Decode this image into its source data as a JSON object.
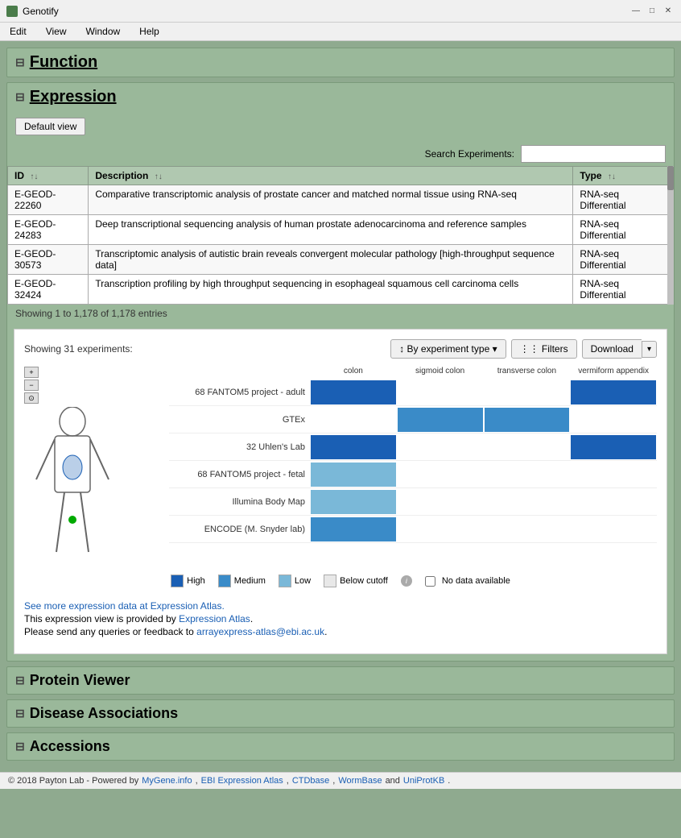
{
  "app": {
    "title": "Genotify",
    "icon": "G"
  },
  "titlebar": {
    "minimize": "—",
    "maximize": "□",
    "close": "✕"
  },
  "menubar": {
    "items": [
      "Edit",
      "View",
      "Window",
      "Help"
    ]
  },
  "function_section": {
    "toggle": "⊟",
    "title": "Function"
  },
  "expression_section": {
    "toggle": "⊟",
    "title": "Expression",
    "default_view_label": "Default view",
    "search_label": "Search Experiments:",
    "search_placeholder": ""
  },
  "table": {
    "columns": [
      {
        "label": "ID",
        "sort": "↑↓"
      },
      {
        "label": "Description",
        "sort": "↑↓"
      },
      {
        "label": "Type",
        "sort": "↑↓"
      }
    ],
    "rows": [
      {
        "id": "E-GEOD-22260",
        "description": "Comparative transcriptomic analysis of prostate cancer and matched normal tissue using RNA-seq",
        "type": "RNA-seq Differential"
      },
      {
        "id": "E-GEOD-24283",
        "description": "Deep transcriptional sequencing analysis of human prostate adenocarcinoma and reference samples",
        "type": "RNA-seq Differential"
      },
      {
        "id": "E-GEOD-30573",
        "description": "Transcriptomic analysis of autistic brain reveals convergent molecular pathology [high-throughput sequence data]",
        "type": "RNA-seq Differential"
      },
      {
        "id": "E-GEOD-32424",
        "description": "Transcription profiling by high throughput sequencing in esophageal squamous cell carcinoma cells",
        "type": "RNA-seq Differential"
      }
    ],
    "footer": "Showing 1 to 1,178 of 1,178 entries"
  },
  "atlas": {
    "showing": "Showing 31 experiments:",
    "by_experiment_btn": "↕ By experiment type ▾",
    "filters_btn": "⋮⋮ Filters",
    "download_btn": "Download",
    "download_arrow": "▾",
    "columns": [
      "colon",
      "sigmoid colon",
      "transverse colon",
      "vermiform appendix"
    ],
    "rows": [
      {
        "label": "68 FANTOM5 project - adult",
        "cells": [
          "high",
          "empty",
          "empty",
          "high"
        ]
      },
      {
        "label": "GTEx",
        "cells": [
          "empty",
          "medium",
          "medium",
          "empty"
        ]
      },
      {
        "label": "32 Uhlen's Lab",
        "cells": [
          "high",
          "empty",
          "empty",
          "high"
        ]
      },
      {
        "label": "68 FANTOM5 project - fetal",
        "cells": [
          "low",
          "empty",
          "empty",
          "empty"
        ]
      },
      {
        "label": "Illumina Body Map",
        "cells": [
          "low",
          "empty",
          "empty",
          "empty"
        ]
      },
      {
        "label": "ENCODE (M. Snyder lab)",
        "cells": [
          "medium",
          "empty",
          "empty",
          "empty"
        ]
      }
    ],
    "legend": [
      {
        "label": "High",
        "color": "high"
      },
      {
        "label": "Medium",
        "color": "medium"
      },
      {
        "label": "Low",
        "color": "low"
      },
      {
        "label": "Below cutoff",
        "color": "below"
      },
      {
        "label": "No data available",
        "color": "no-data"
      }
    ],
    "link_text": "See more expression data at Expression Atlas.",
    "link_href": "#",
    "info_line1": "This expression view is provided by",
    "info_link1": "Expression Atlas",
    "info_href1": "#",
    "info_line2": "Please send any queries or feedback to",
    "info_link2": "arrayexpress-atlas@ebi.ac.uk",
    "info_href2": "mailto:arrayexpress-atlas@ebi.ac.uk"
  },
  "protein_viewer": {
    "toggle": "⊟",
    "title": "Protein Viewer"
  },
  "disease_associations": {
    "toggle": "⊟",
    "title": "Disease Associations"
  },
  "accessions": {
    "toggle": "⊟",
    "title": "Accessions"
  },
  "footer": {
    "copyright": "© 2018 Payton Lab - Powered by",
    "links": [
      {
        "label": "MyGene.info",
        "href": "#"
      },
      {
        "label": "EBI Expression Atlas",
        "href": "#"
      },
      {
        "label": "CTDbase",
        "href": "#"
      },
      {
        "label": "WormBase",
        "href": "#"
      },
      {
        "label": "and",
        "href": null
      },
      {
        "label": "UniProtKB",
        "href": "#"
      }
    ]
  }
}
